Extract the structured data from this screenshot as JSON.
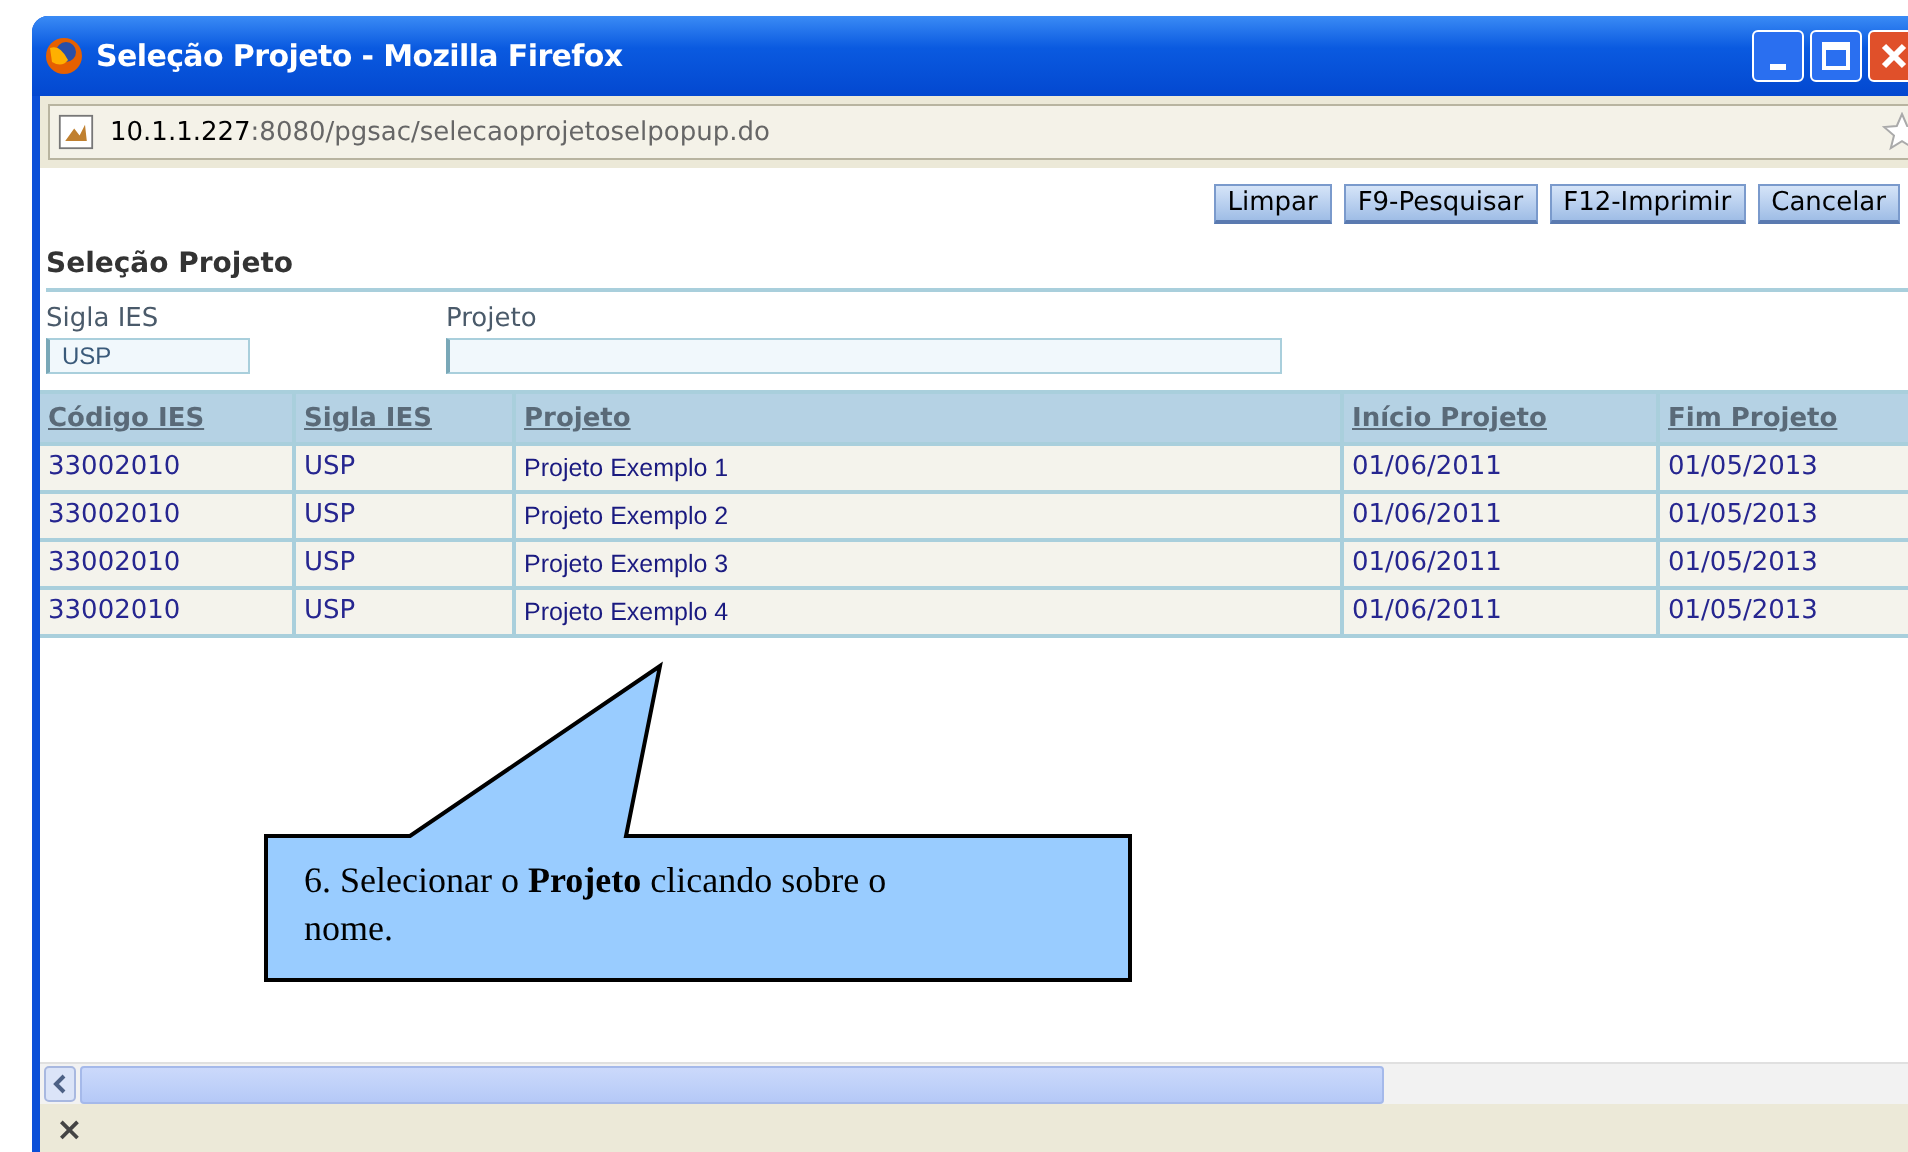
{
  "window": {
    "title": "Seleção Projeto - Mozilla Firefox"
  },
  "address_bar": {
    "host": "10.1.1.227",
    "path": ":8080/pgsac/selecaoprojetoselpopup.do"
  },
  "buttons": [
    "Limpar",
    "F9-Pesquisar",
    "F12-Imprimir",
    "Cancelar"
  ],
  "section_title": "Seleção Projeto",
  "filters": [
    {
      "label": "Sigla IES",
      "value": "USP"
    },
    {
      "label": "Projeto"
    }
  ],
  "table": {
    "columns": [
      "Código IES",
      "Sigla IES",
      "Projeto",
      "Início Projeto",
      "Fim Projeto"
    ],
    "rows": [
      [
        "33002010",
        "USP",
        "Projeto Exemplo 1",
        "01/06/2011",
        "01/05/2013"
      ],
      [
        "33002010",
        "USP",
        "Projeto Exemplo 2",
        "01/06/2011",
        "01/05/2013"
      ],
      [
        "33002010",
        "USP",
        "Projeto Exemplo 3",
        "01/06/2011",
        "01/05/2013"
      ],
      [
        "33002010",
        "USP",
        "Projeto Exemplo 4",
        "01/06/2011",
        "01/05/2013"
      ]
    ]
  },
  "callout": {
    "text": "6. Selecionar o **Projeto** clicando sobre o nome."
  },
  "status_bar": {
    "close_glyph": "×"
  }
}
